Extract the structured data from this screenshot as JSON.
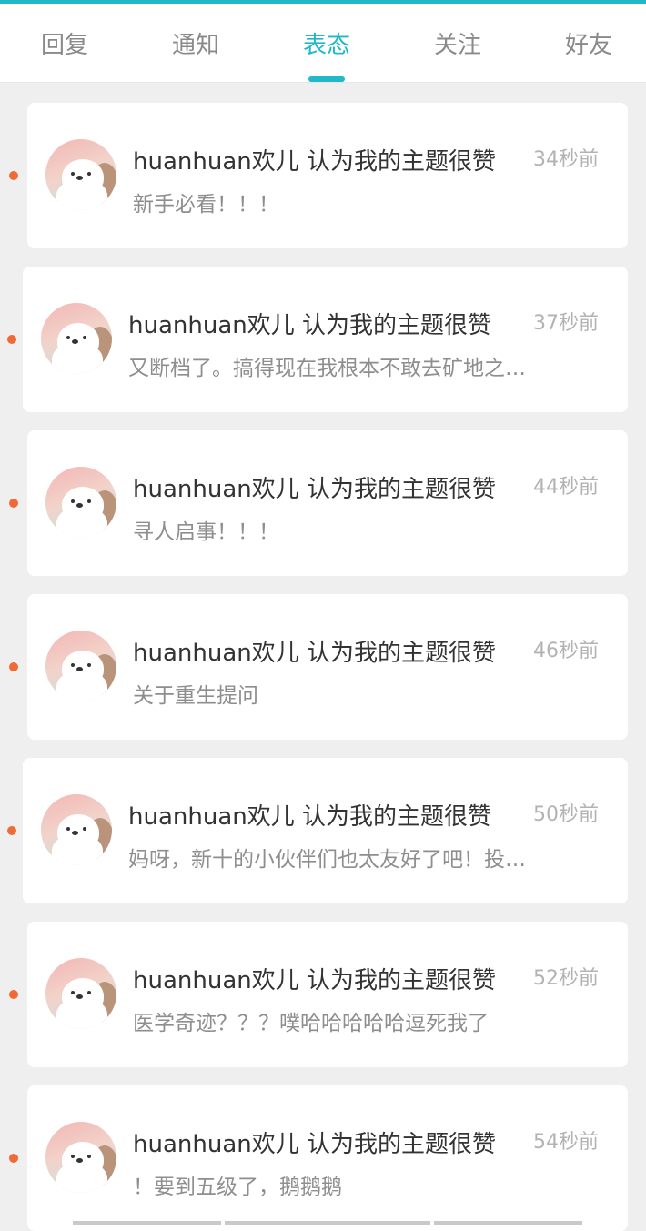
{
  "tabs": [
    "回复",
    "通知",
    "表态",
    "关注",
    "好友"
  ],
  "active_tab": "表态",
  "notifications": [
    {
      "user": "huanhuan欢儿",
      "action": "认为我的主题很赞",
      "time": "34秒前",
      "content": "新手必看！！！"
    },
    {
      "user": "huanhuan欢儿",
      "action": "认为我的主题很赞",
      "time": "37秒前",
      "content": "又断档了。搞得现在我根本不敢去矿地之…"
    },
    {
      "user": "huanhuan欢儿",
      "action": "认为我的主题很赞",
      "time": "44秒前",
      "content": "寻人启事！！！"
    },
    {
      "user": "huanhuan欢儿",
      "action": "认为我的主题很赞",
      "time": "46秒前",
      "content": "关于重生提问"
    },
    {
      "user": "huanhuan欢儿",
      "action": "认为我的主题很赞",
      "time": "50秒前",
      "content": "妈呀，新十的小伙伴们也太友好了吧！投…"
    },
    {
      "user": "huanhuan欢儿",
      "action": "认为我的主题很赞",
      "time": "52秒前",
      "content": "医学奇迹？？？噗哈哈哈哈哈逗死我了"
    },
    {
      "user": "huanhuan欢儿",
      "action": "认为我的主题很赞",
      "time": "54秒前",
      "content": "！要到五级了，鹅鹅鹅"
    }
  ],
  "colors": {
    "accent": "#23b8c6",
    "unread_dot": "#f06a36"
  }
}
